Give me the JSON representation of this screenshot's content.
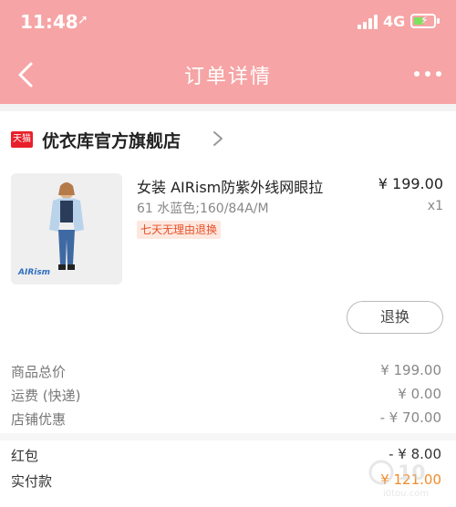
{
  "status_bar": {
    "time": "11:48",
    "location_glyph": "➚",
    "network": "4G",
    "battery_color": "#7ee05f"
  },
  "nav": {
    "title": "订单详情"
  },
  "store": {
    "badge": "天猫",
    "name": "优衣库官方旗舰店"
  },
  "item": {
    "title": "女装 AIRism防紫外线网眼拉",
    "price": "¥ 199.00",
    "spec": "61 水蓝色;160/84A/M",
    "qty": "x1",
    "tag": "七天无理由退换",
    "thumb_brand": "AIRism"
  },
  "actions": {
    "refund_label": "退换"
  },
  "summary": [
    {
      "label": "商品总价",
      "value": "¥ 199.00"
    },
    {
      "label": "运费 (快递)",
      "value": "¥ 0.00"
    },
    {
      "label": "店铺优惠",
      "value": "- ¥ 70.00"
    }
  ],
  "payment": [
    {
      "label": "红包",
      "value": "- ¥ 8.00"
    },
    {
      "label": "实付款",
      "value": "¥ 121.00"
    }
  ],
  "colors": {
    "header_bg": "#f6a4a5",
    "tmall_red": "#e8202a",
    "tag_orange": "#e8502a",
    "pay_orange": "#f08c2a"
  }
}
